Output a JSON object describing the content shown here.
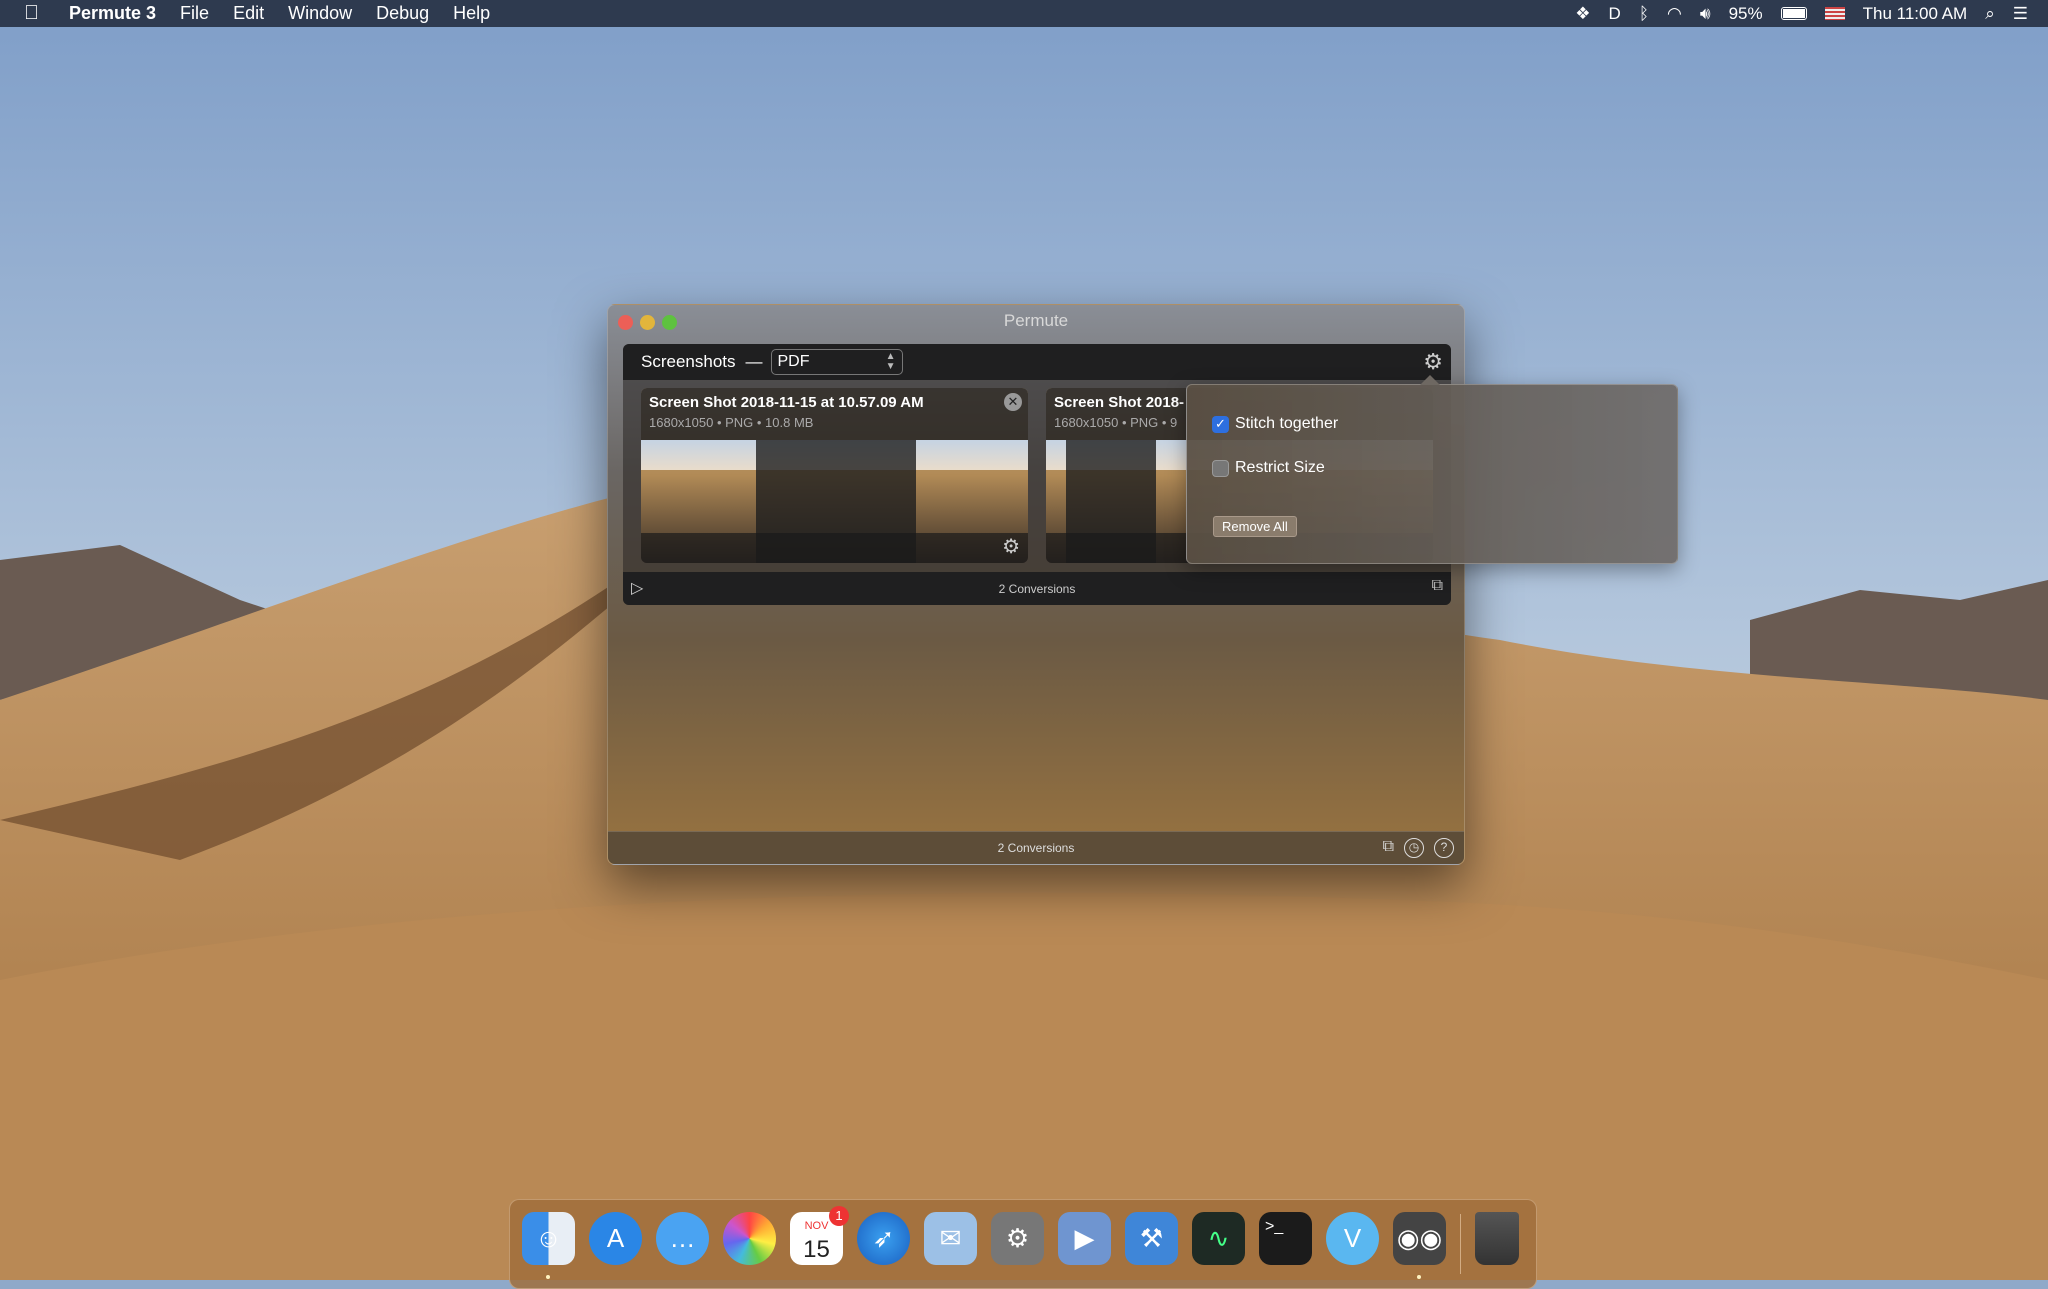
{
  "menubar": {
    "app": "Permute 3",
    "items": [
      "File",
      "Edit",
      "Window",
      "Debug",
      "Help"
    ],
    "battery": "95%",
    "clock": "Thu 11:00 AM"
  },
  "window": {
    "title": "Permute",
    "preset": {
      "name": "Screenshots",
      "format": "PDF"
    },
    "files": [
      {
        "name": "Screen Shot 2018-11-15 at 10.57.09 AM",
        "meta": "1680x1050 • PNG • 10.8 MB"
      },
      {
        "name": "Screen Shot 2018-",
        "meta": "1680x1050 • PNG • 9"
      }
    ],
    "group_status": "2 Conversions",
    "status": "2 Conversions"
  },
  "popover": {
    "stitch_label": "Stitch together",
    "stitch_checked": true,
    "restrict_label": "Restrict Size",
    "restrict_checked": false,
    "remove_all": "Remove All"
  },
  "dock": {
    "apps": [
      "Finder",
      "App Store",
      "Messages",
      "Photos",
      "Calendar",
      "Safari",
      "Mail",
      "System Preferences",
      "Script",
      "Xcode",
      "Activity Monitor",
      "Terminal",
      "Vectornator",
      "Permute",
      "Trash"
    ],
    "calendar": {
      "month": "NOV",
      "day": "15",
      "badge": "1"
    }
  },
  "colors": {
    "accent": "#2d6fe0",
    "menubar": "#2e3a4f"
  }
}
